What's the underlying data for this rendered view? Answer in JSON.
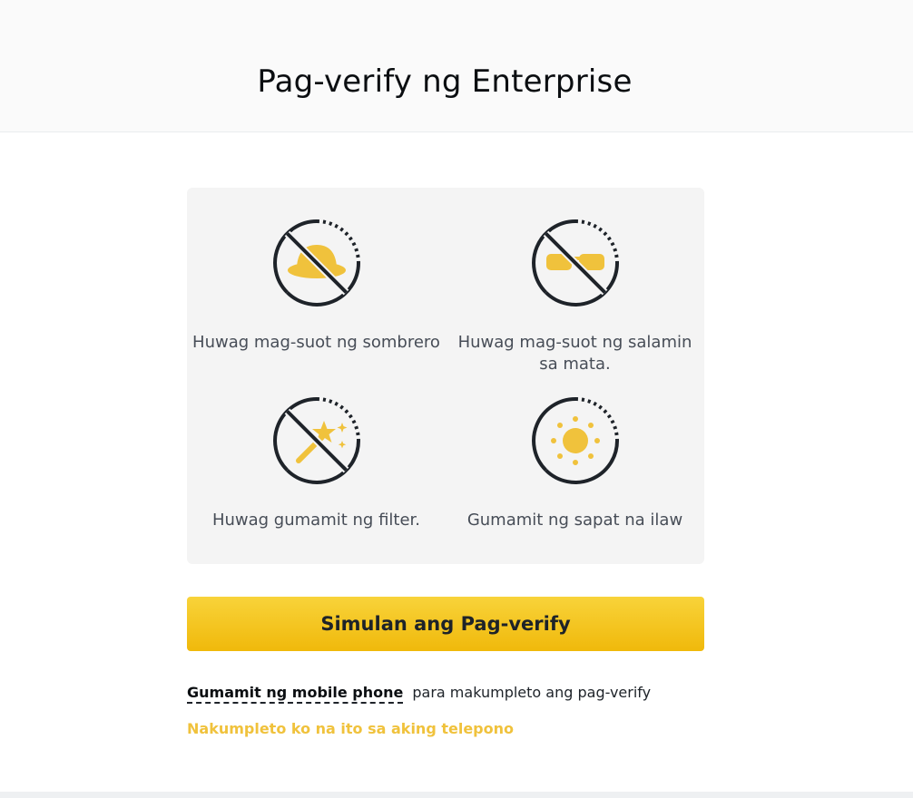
{
  "header": {
    "title": "Pag-verify ng Enterprise"
  },
  "tips": [
    {
      "icon": "no-hat-icon",
      "label": "Huwag mag-suot ng sombrero"
    },
    {
      "icon": "no-glasses-icon",
      "label": "Huwag mag-suot ng salamin sa mata."
    },
    {
      "icon": "no-filter-icon",
      "label": "Huwag gumamit ng filter."
    },
    {
      "icon": "sun-icon",
      "label": "Gumamit ng sapat na ilaw"
    }
  ],
  "actions": {
    "start_label": "Simulan ang Pag-verify"
  },
  "mobile": {
    "link_label": "Gumamit ng mobile phone",
    "rest_text": "para makumpleto ang pag-verify"
  },
  "done_link": "Nakumpleto ko na ito sa aking telepono",
  "colors": {
    "accent": "#f0b90b",
    "icon_dark": "#1e2329",
    "icon_yellow": "#f0c23c"
  }
}
